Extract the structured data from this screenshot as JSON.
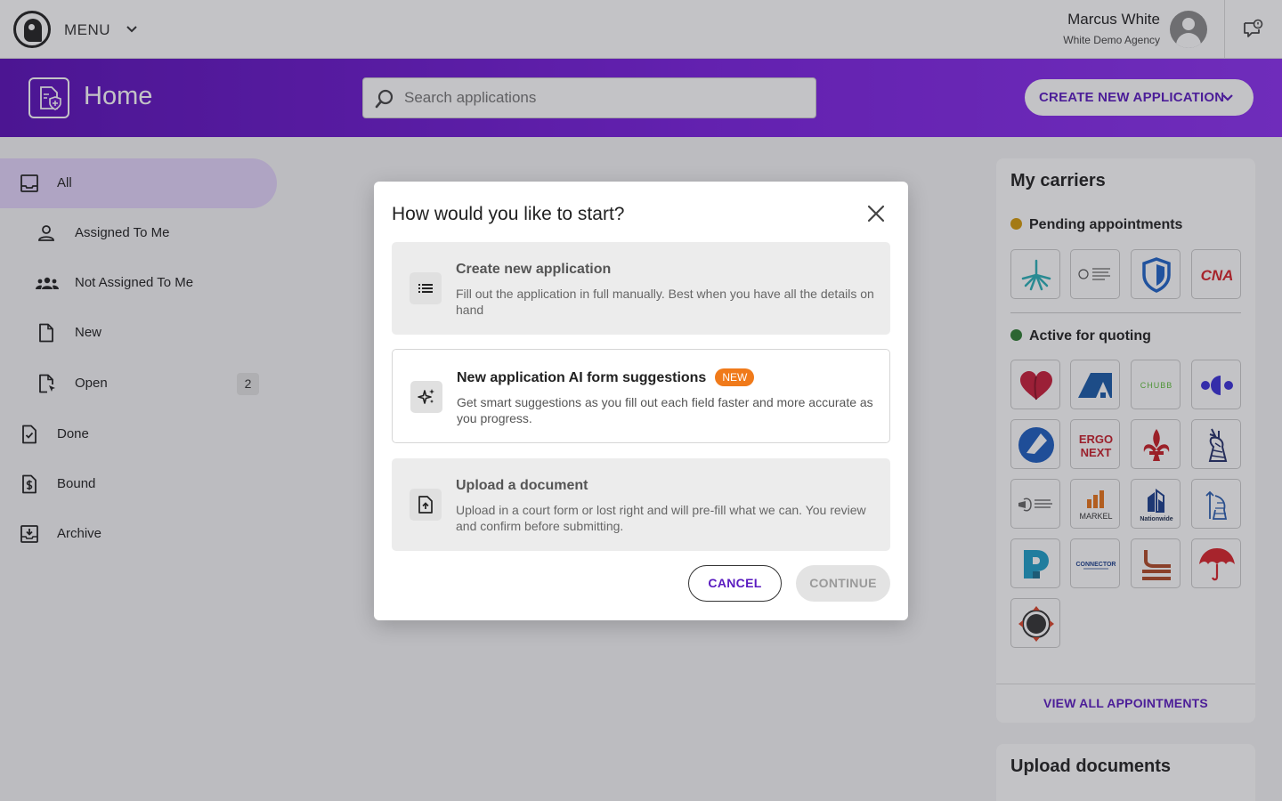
{
  "topbar": {
    "menu_label": "MENU",
    "user_name": "Marcus White",
    "agency": "White Demo Agency",
    "icons": [
      "toucan-logo-icon",
      "chevron-down-icon",
      "user-avatar-icon",
      "help-chat-icon"
    ]
  },
  "header": {
    "title": "Home",
    "search_placeholder": "Search applications",
    "create_button": "CREATE NEW APPLICATION",
    "gradient_colors": [
      "#5a0fb8",
      "#8b2ff0"
    ]
  },
  "sidebar": {
    "items": [
      {
        "label": "All",
        "icon": "inbox-icon",
        "active": true
      },
      {
        "label": "Assigned To Me",
        "icon": "person-icon"
      },
      {
        "label": "Not Assigned To Me",
        "icon": "people-icon"
      },
      {
        "label": "New",
        "icon": "document-icon"
      },
      {
        "label": "Open",
        "icon": "document-cursor-icon",
        "count": "2"
      },
      {
        "label": "Done",
        "icon": "document-check-icon"
      },
      {
        "label": "Bound",
        "icon": "document-dollar-icon"
      },
      {
        "label": "Archive",
        "icon": "archive-icon"
      }
    ]
  },
  "carriers": {
    "title": "My carriers",
    "pending_label": "Pending appointments",
    "active_label": "Active for quoting",
    "pending_dot_color": "#d49a0a",
    "active_dot_color": "#2e7d32",
    "logo_texts": {
      "cna": "CNA",
      "chubb": "CHUBB",
      "ergo_top": "ERGO",
      "ergo_bottom": "NEXT",
      "markel": "MARKEL",
      "nationwide": "Nationwide",
      "connector": "CONNECTOR"
    },
    "view_all": "VIEW ALL APPOINTMENTS"
  },
  "upload": {
    "title": "Upload documents"
  },
  "modal": {
    "title": "How would you like to start?",
    "options": [
      {
        "title": "Create new application",
        "desc": "Fill out the application in full manually.  Best when you have all the details on hand",
        "icon": "list-icon"
      },
      {
        "title": "New application AI form suggestions",
        "badge": "NEW",
        "desc": "Get smart suggestions as you fill out each field faster and more accurate as you progress.",
        "icon": "sparkles-icon"
      },
      {
        "title": "Upload a document",
        "desc": "Upload in a court form or lost right and will pre-fill what we can. You review and confirm before submitting.",
        "icon": "file-upload-icon"
      }
    ],
    "cancel": "CANCEL",
    "continue": "CONTINUE",
    "badge_color": "#f07a1a"
  }
}
